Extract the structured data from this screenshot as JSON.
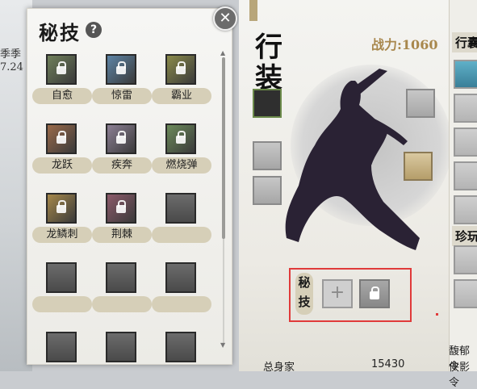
{
  "left_background": {
    "line1": "季季",
    "line2": "7.24"
  },
  "skill_panel": {
    "title": "秘技",
    "help_icon": "question-icon",
    "close_icon": "close-icon",
    "skills": [
      {
        "name": "自愈",
        "color": "#6f7f5a"
      },
      {
        "name": "惊雷",
        "color": "#5d84a6"
      },
      {
        "name": "霸业",
        "color": "#8a8a4a"
      },
      {
        "name": "龙跃",
        "color": "#9a6a4a"
      },
      {
        "name": "疾奔",
        "color": "#8c7f94"
      },
      {
        "name": "燃烧弹",
        "color": "#6c8a5a"
      },
      {
        "name": "龙鳞刺",
        "color": "#a6884a"
      },
      {
        "name": "荆棘",
        "color": "#8c5a6a"
      },
      {
        "name": "",
        "color": ""
      },
      {
        "name": "",
        "color": ""
      },
      {
        "name": "",
        "color": ""
      },
      {
        "name": "",
        "color": ""
      },
      {
        "name": "",
        "color": ""
      },
      {
        "name": "",
        "color": ""
      },
      {
        "name": "",
        "color": ""
      }
    ]
  },
  "gear_panel": {
    "title": "行装",
    "power_label": "战力:",
    "power_value": "1060",
    "secret_skill_tag": "秘技",
    "add_icon": "plus-icon",
    "locked_slot_icon": "lock-icon",
    "bottom_label": "总身家",
    "bottom_value": "15430"
  },
  "far_right": {
    "tab_top": "行囊",
    "tab_mid": "珍玩",
    "bottom_line1": "馥郁令",
    "bottom_line2": "侠影令"
  }
}
